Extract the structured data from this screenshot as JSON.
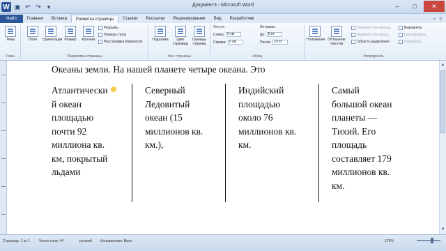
{
  "window": {
    "title": "Документ3 - Microsoft Word",
    "app_icon_letter": "W",
    "controls": {
      "minimize": "–",
      "maximize": "□",
      "close": "✕"
    }
  },
  "tabs": [
    "Файл",
    "Главная",
    "Вставка",
    "Разметка страницы",
    "Ссылки",
    "Рассылки",
    "Рецензирование",
    "Вид",
    "Разработчик"
  ],
  "active_tab_index": 3,
  "ribbon": {
    "themes": {
      "big": "Темы",
      "label": "Темы"
    },
    "page_setup": {
      "buttons": [
        "Поля",
        "Ориентация",
        "Размер",
        "Колонки"
      ],
      "small": [
        "Разрывы",
        "Номера строк",
        "Расстановка переносов"
      ],
      "label": "Параметры страницы"
    },
    "background": {
      "buttons": [
        "Подложка",
        "Цвет страницы",
        "Границы страниц"
      ],
      "label": "Фон страницы"
    },
    "paragraph": {
      "indent_header": "Отступ",
      "left_label": "Слева:",
      "left_value": "0 см",
      "right_label": "Справа:",
      "right_value": "0 см",
      "spacing_header": "Интервал",
      "before_label": "До:",
      "before_value": "0 пт",
      "after_label": "После:",
      "after_value": "10 пт",
      "label": "Абзац"
    },
    "arrange": {
      "buttons": [
        "Положение",
        "Обтекание текстом"
      ],
      "small": [
        "Переместить вперед",
        "Переместить назад",
        "Область выделения",
        "Выровнять",
        "Группировать",
        "Повернуть"
      ],
      "label": "Упорядочить"
    }
  },
  "document": {
    "first_line": "Океаны земли. На нашей планете четыре океана. Это",
    "columns": [
      "Атлантически\nй океан\nплощадью\nпочти 92\nмиллиона кв.\nкм, покрытый\nльдами",
      "Северный\nЛедовитый\nокеан (15\nмиллионов кв.\nкм.),",
      "Индийский\nплощадью\nоколо 76\nмиллионов кв.\nкм.",
      "Самый\nбольшой океан\nпланеты —\nТихий. Его\nплощадь\nсоставляет 179\nмиллионов кв.\nкм."
    ]
  },
  "statusbar": {
    "page": "Страница: 1 из 1",
    "words": "Число слов: 44",
    "language": "русский",
    "insert_mode": "Исправления: Выкл",
    "zoom": "179%"
  }
}
